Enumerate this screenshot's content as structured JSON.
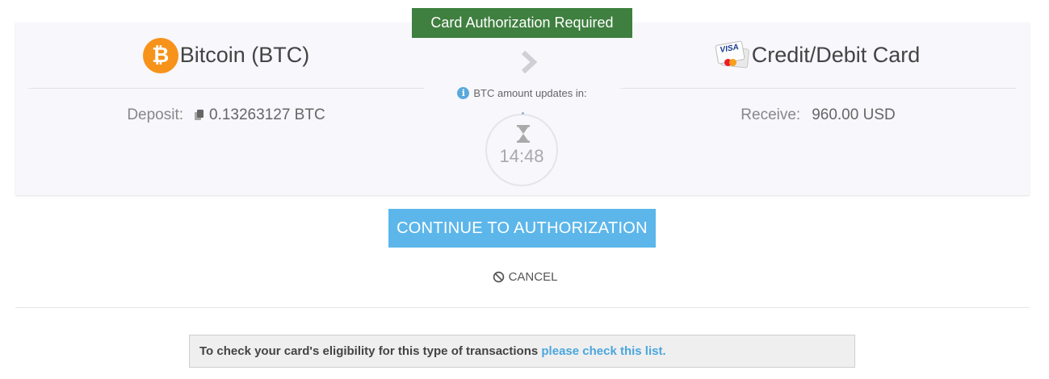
{
  "banner": {
    "text": "Card Authorization Required"
  },
  "from": {
    "currency_name": "Bitcoin (BTC)",
    "icon_symbol": "₿",
    "deposit_label": "Deposit:",
    "deposit_value": "0.13263127 BTC"
  },
  "to": {
    "method_name": "Credit/Debit Card",
    "card_brand": "VISA",
    "receive_label": "Receive:",
    "receive_value": "960.00 USD"
  },
  "timer": {
    "note": "BTC amount updates in:",
    "info_symbol": "i",
    "remaining": "14:48"
  },
  "actions": {
    "continue_label": "CONTINUE TO AUTHORIZATION",
    "cancel_label": "CANCEL"
  },
  "notice": {
    "text": "To check your card's eligibility for this type of transactions ",
    "link_text": "please check this list."
  },
  "colors": {
    "banner_bg": "#3f7f3f",
    "button_bg": "#5cb6ea",
    "link": "#4aa6dd",
    "bitcoin": "#f7931a"
  },
  "icons": [
    "bitcoin-icon",
    "credit-card-icon",
    "copy-icon",
    "chevron-right-icon",
    "info-icon",
    "hourglass-icon",
    "ban-icon"
  ]
}
